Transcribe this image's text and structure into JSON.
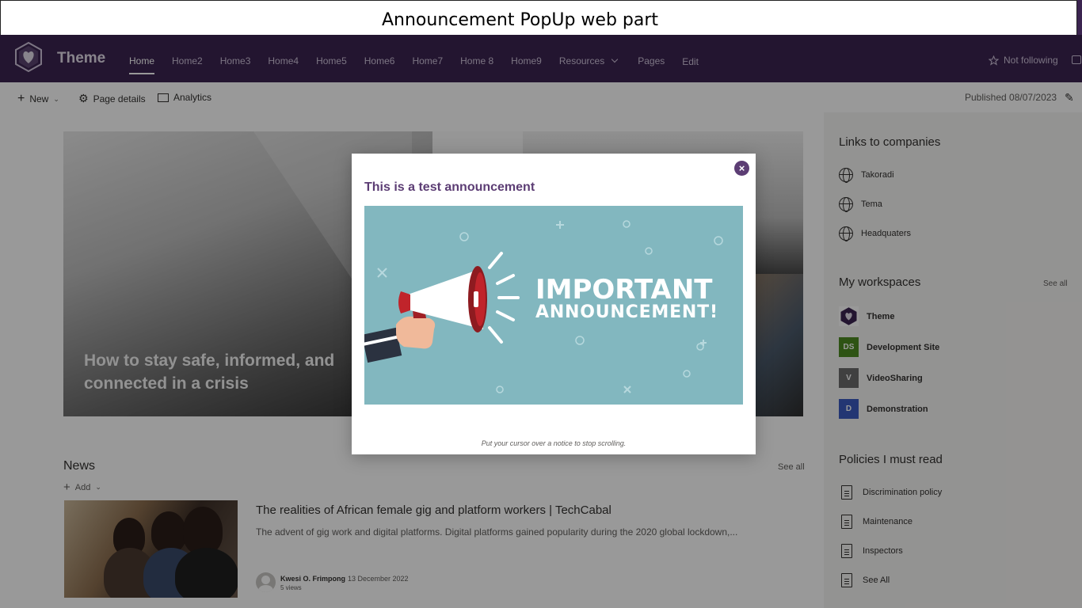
{
  "banner": {
    "title": "Announcement PopUp web part"
  },
  "suitebar": {
    "site_title": "Theme",
    "nav": [
      "Home",
      "Home2",
      "Home3",
      "Home4",
      "Home5",
      "Home6",
      "Home7",
      "Home 8",
      "Home9",
      "Resources",
      "Pages",
      "Edit"
    ],
    "follow_label": "Not following"
  },
  "cmdbar": {
    "new_label": "New",
    "page_details_label": "Page details",
    "analytics_label": "Analytics",
    "published_label": "Published 08/07/2023"
  },
  "hero": {
    "headline": "How to stay safe, informed, and connected in a crisis"
  },
  "news": {
    "title": "News",
    "see_all": "See all",
    "add_label": "Add",
    "headline": "The realities of African female gig and platform workers | TechCabal",
    "description": "The advent of gig work and digital platforms. Digital platforms gained popularity during the 2020 global lockdown,...",
    "author": "Kwesi O. Frimpong",
    "date": "13 December 2022",
    "views": "5 views"
  },
  "sidebar": {
    "links_title": "Links to companies",
    "links": [
      "Takoradi",
      "Tema",
      "Headquaters"
    ],
    "workspaces_title": "My workspaces",
    "workspaces_see_all": "See all",
    "workspaces": [
      {
        "label": "Theme",
        "initials": "",
        "color": "#3b2450"
      },
      {
        "label": "Development Site",
        "initials": "DS",
        "color": "#4e8a22"
      },
      {
        "label": "VideoSharing",
        "initials": "V",
        "color": "#6b6b6b"
      },
      {
        "label": "Demonstration",
        "initials": "D",
        "color": "#3b5bc0"
      }
    ],
    "policies_title": "Policies I must read",
    "policies": [
      "Discrimination policy",
      "Maintenance",
      "Inspectors",
      "See All"
    ]
  },
  "modal": {
    "title": "This is a test announcement",
    "close_glyph": "×",
    "image_line1": "IMPORTANT",
    "image_line2": "ANNOUNCEMENT!",
    "caption": "Put your cursor over a notice to stop scrolling."
  },
  "colors": {
    "suitebar": "#3b2450",
    "accent": "#5c3d74",
    "announcement_bg": "#82b7bf"
  }
}
